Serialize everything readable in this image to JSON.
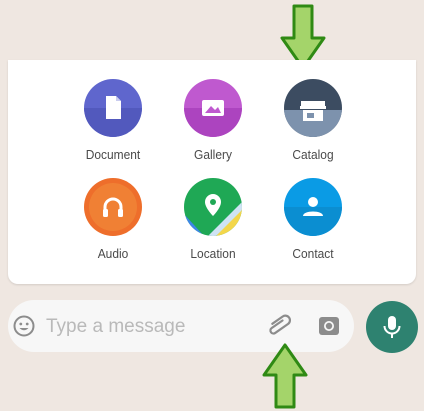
{
  "attach_menu": {
    "items": [
      {
        "label": "Document",
        "icon": "document-icon",
        "color": "#5f66cd"
      },
      {
        "label": "Gallery",
        "icon": "gallery-icon",
        "color": "#bf59cf"
      },
      {
        "label": "Catalog",
        "icon": "catalog-icon",
        "color": "#3c4c61"
      },
      {
        "label": "Audio",
        "icon": "headphones-icon",
        "color": "#ee6e2b"
      },
      {
        "label": "Location",
        "icon": "location-icon",
        "color": "#1fa855"
      },
      {
        "label": "Contact",
        "icon": "contact-icon",
        "color": "#0a9be5"
      }
    ]
  },
  "composer": {
    "placeholder": "Type a message",
    "emoji_icon": "emoji-icon",
    "attach_icon": "paperclip-icon",
    "camera_icon": "camera-icon",
    "mic_icon": "mic-icon",
    "mic_color": "#2e8270"
  },
  "annotations": {
    "arrow_color": "#5aa11e",
    "arrows": [
      "down-arrow-icon",
      "up-arrow-icon"
    ]
  }
}
